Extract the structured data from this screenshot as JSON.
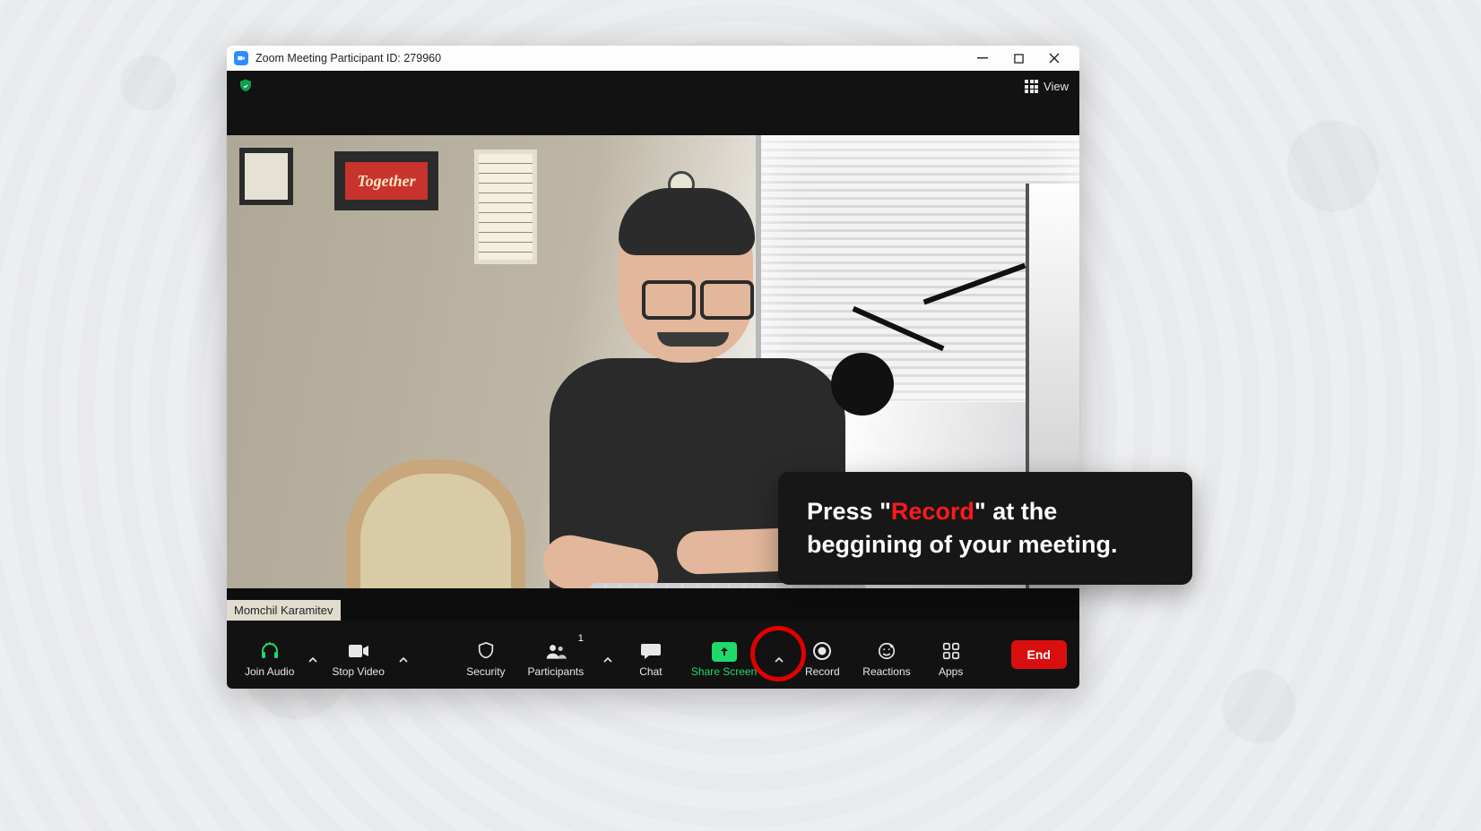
{
  "titlebar": {
    "title": "Zoom Meeting Participant ID: 279960"
  },
  "topbar": {
    "view_label": "View"
  },
  "participant": {
    "name": "Momchil Karamitev"
  },
  "callout": {
    "pre": "Press \"",
    "highlight": "Record",
    "post": "\" at the beggining of your meeting."
  },
  "toolbar": {
    "join_audio": "Join Audio",
    "stop_video": "Stop Video",
    "security": "Security",
    "participants": "Participants",
    "participants_count": "1",
    "chat": "Chat",
    "share_screen": "Share Screen",
    "record": "Record",
    "reactions": "Reactions",
    "apps": "Apps",
    "end": "End"
  },
  "scene": {
    "frame2_text": "Together"
  }
}
